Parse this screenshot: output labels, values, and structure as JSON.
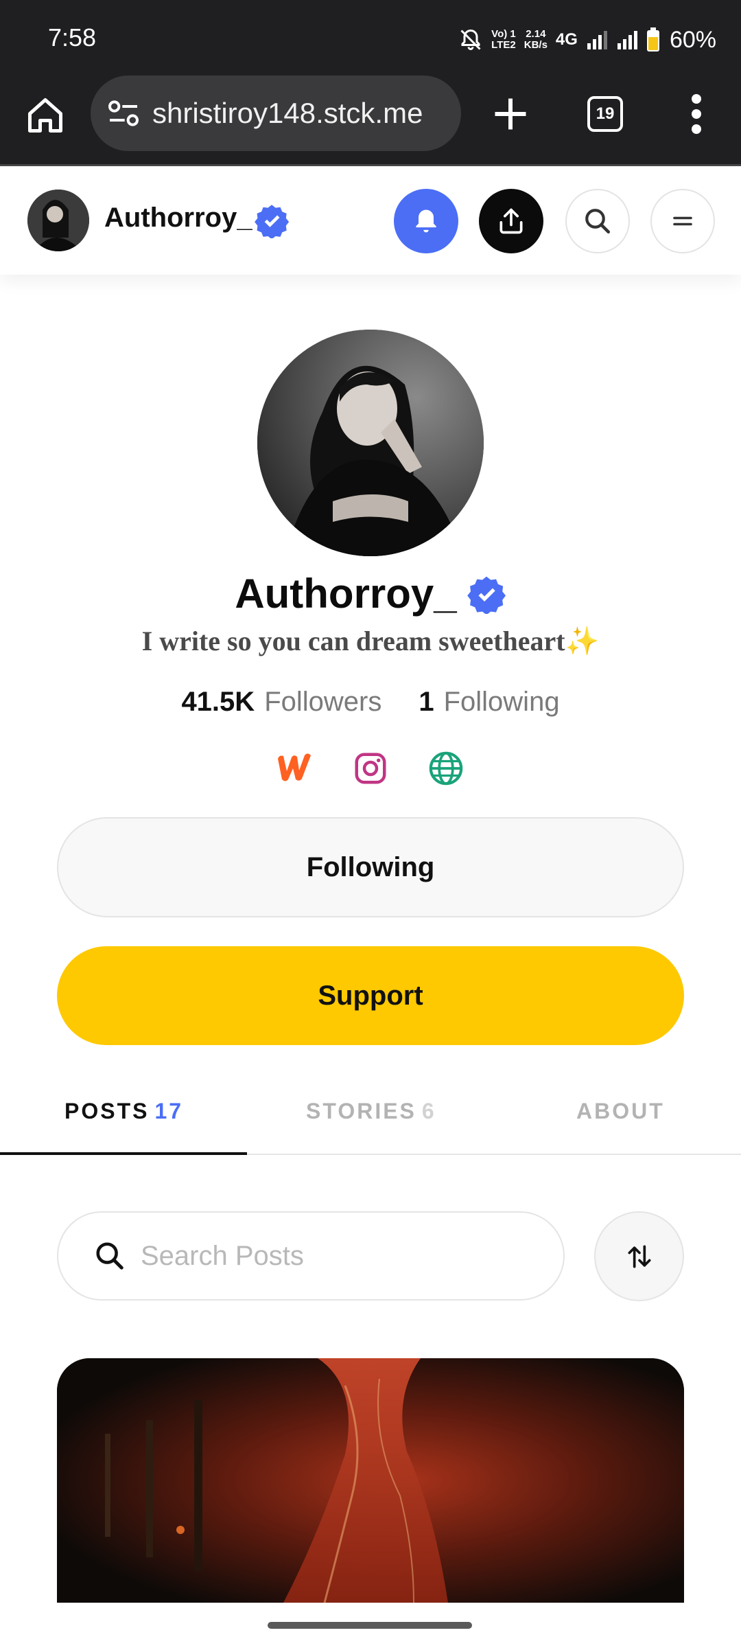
{
  "status_bar": {
    "time": "7:58",
    "volte": "Vo) 1",
    "lte": "LTE2",
    "speed_value": "2.14",
    "speed_unit": "KB/s",
    "network": "4G",
    "battery": "60%"
  },
  "browser": {
    "url": "shristiroy148.stck.me",
    "tab_count": "19"
  },
  "header": {
    "username": "Authorroy_"
  },
  "profile": {
    "name": "Authorroy_",
    "bio": "I write so you can dream sweetheart",
    "bio_emoji": "✨",
    "followers_count": "41.5K",
    "followers_label": "Followers",
    "following_count": "1",
    "following_label": "Following",
    "follow_button": "Following",
    "support_button": "Support"
  },
  "tabs": {
    "posts_label": "POSTS",
    "posts_count": "17",
    "stories_label": "STORIES",
    "stories_count": "6",
    "about_label": "ABOUT"
  },
  "search": {
    "placeholder": "Search Posts"
  },
  "colors": {
    "accent": "#4b6ef5",
    "support": "#fec900",
    "instagram": "#c13584",
    "globe": "#1aa37a",
    "wattpad": "#ff6122"
  }
}
